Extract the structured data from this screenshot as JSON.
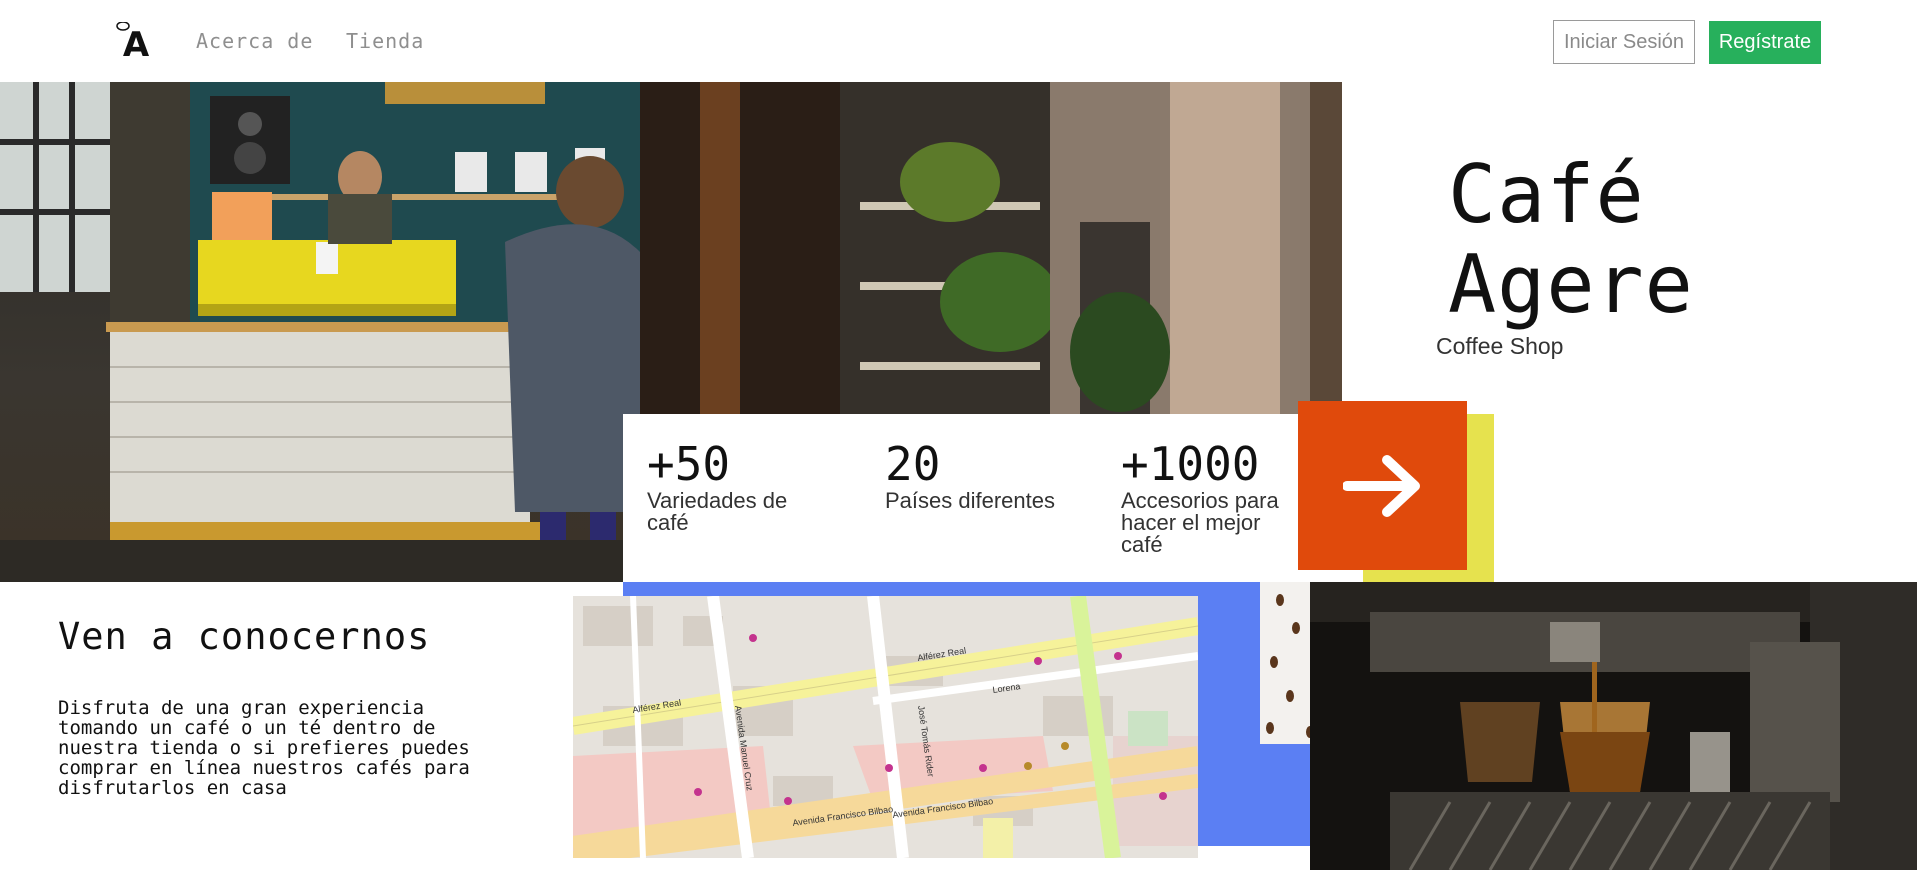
{
  "header": {
    "logo_letter": "A",
    "nav": [
      {
        "label": "Acerca de"
      },
      {
        "label": "Tienda"
      }
    ],
    "login_label": "Iniciar Sesión",
    "register_label": "Regístrate"
  },
  "hero": {
    "title": "Café\nAgere",
    "subtitle": "Coffee Shop"
  },
  "stats": [
    {
      "value": "+50",
      "label": "Variedades de café"
    },
    {
      "value": "20",
      "label": "Países diferentes"
    },
    {
      "value": "+1000",
      "label": "Accesorios para hacer el mejor café"
    }
  ],
  "about": {
    "title": "Ven a conocernos",
    "body": "Disfruta de una gran experiencia tomando un café o un té dentro de nuestra tienda o si prefieres puedes comprar en línea nuestros cafés para disfrutarlos en casa"
  },
  "map": {
    "streets": [
      "Alférez Real",
      "Alférez Real",
      "Lorena",
      "Avenida Francisco Bilbao",
      "Avenida Francisco Bilbao",
      "Avenida Manuel Cruz",
      "José Tomás Rider"
    ]
  },
  "colors": {
    "accent_orange": "#e04a0c",
    "accent_yellow": "#e6e24e",
    "accent_blue": "#5b7ff3",
    "register_green": "#27b05c"
  },
  "icons": {
    "arrow": "arrow-right-icon"
  }
}
